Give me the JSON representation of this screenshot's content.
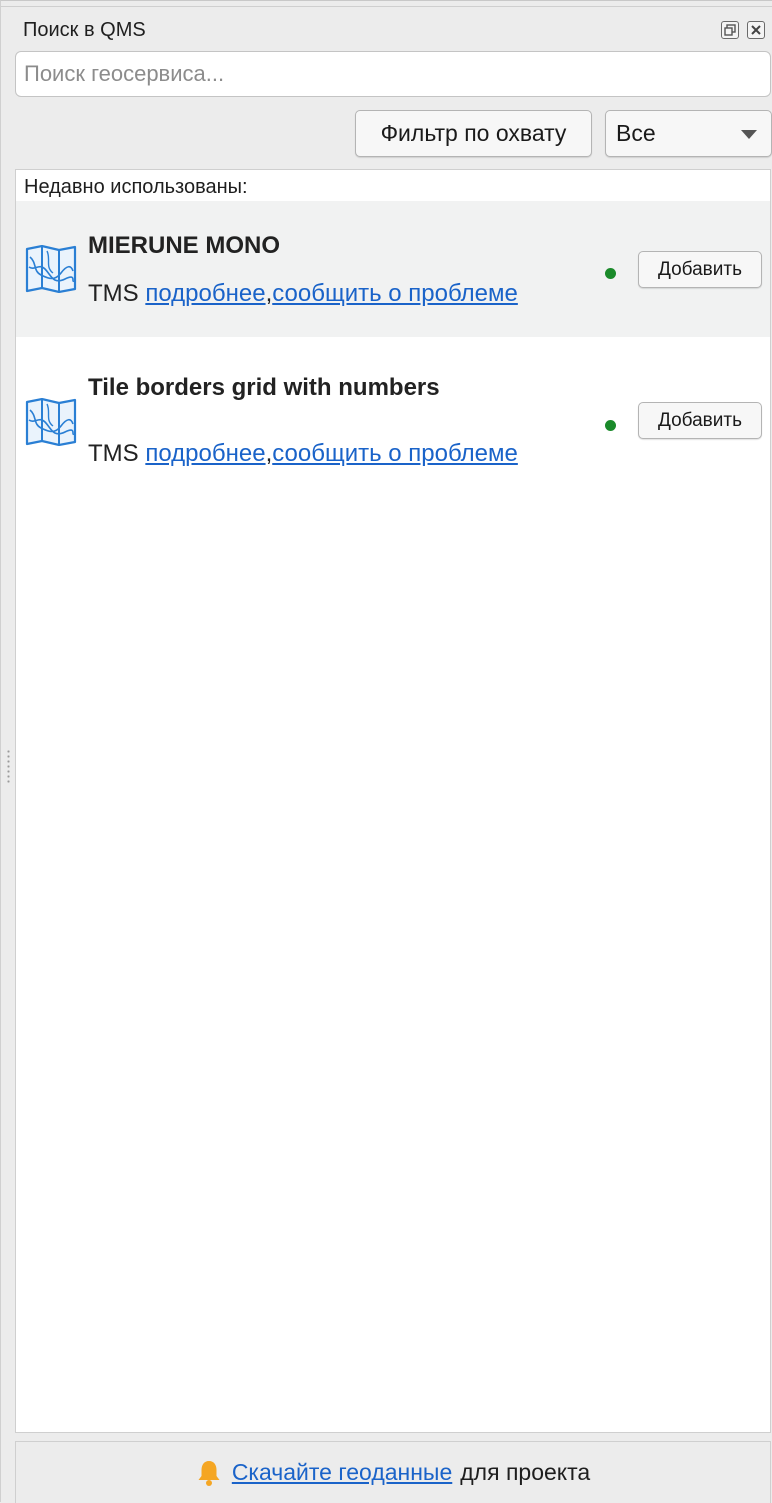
{
  "panel": {
    "title": "Поиск в QMS",
    "float_button": "float-icon",
    "close_button": "close-icon"
  },
  "search": {
    "placeholder": "Поиск геосервиса...",
    "value": ""
  },
  "filter": {
    "extent_button_label": "Фильтр по охвату",
    "type_select_value": "Все"
  },
  "results": {
    "header": "Недавно использованы:",
    "items": [
      {
        "title": "MIERUNE MONO",
        "type": "TMS",
        "details_link": "подробнее",
        "separator": ",",
        "report_link": "сообщить о проблеме",
        "status_color": "#1a8a2a",
        "add_label": "Добавить",
        "icon": "map-icon"
      },
      {
        "title": "Tile borders grid with numbers",
        "type": "TMS",
        "details_link": "подробнее",
        "separator": ",",
        "report_link": "сообщить о проблеме",
        "status_color": "#1a8a2a",
        "add_label": "Добавить",
        "icon": "map-icon"
      }
    ]
  },
  "footer": {
    "icon": "bell-icon",
    "link": "Скачайте геоданные",
    "text": "для проекта"
  },
  "colors": {
    "link": "#1a63c9",
    "status_ok": "#1a8a2a",
    "bell": "#f5a623",
    "map_icon": "#2a7fd4"
  }
}
